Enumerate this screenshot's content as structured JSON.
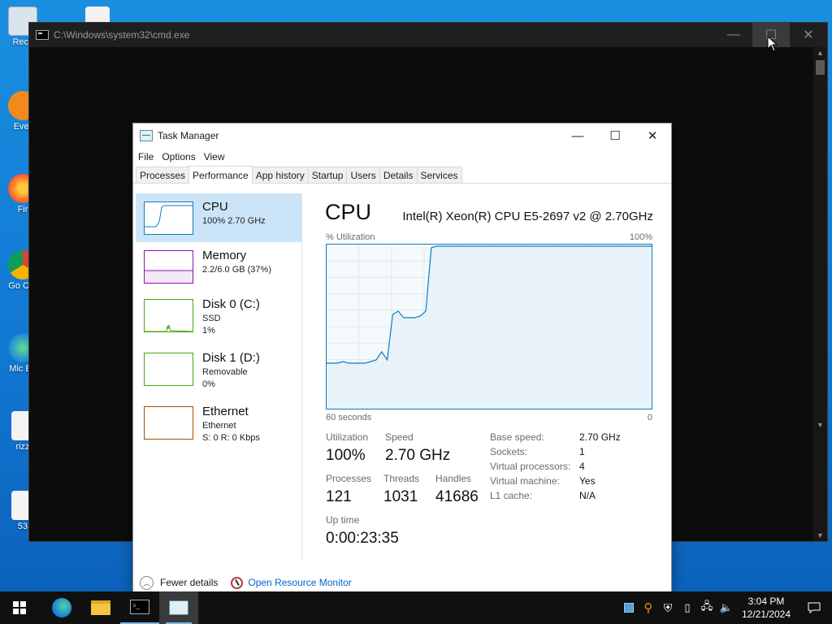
{
  "desktop": {
    "icons": [
      {
        "label": "Recy"
      },
      {
        "label": "Ever"
      },
      {
        "label": "Fir"
      },
      {
        "label": "Go Chr"
      },
      {
        "label": "Mic Ed"
      },
      {
        "label": "rizz"
      },
      {
        "label": "53"
      }
    ]
  },
  "cmd": {
    "title": "C:\\Windows\\system32\\cmd.exe",
    "minimize": "—",
    "maximize": "☐",
    "close": "✕"
  },
  "taskmgr": {
    "title": "Task Manager",
    "window_buttons": {
      "minimize": "—",
      "maximize": "☐",
      "close": "✕"
    },
    "menu": [
      "File",
      "Options",
      "View"
    ],
    "tabs": [
      "Processes",
      "Performance",
      "App history",
      "Startup",
      "Users",
      "Details",
      "Services"
    ],
    "selected_tab": "Performance",
    "resources": [
      {
        "name": "CPU",
        "sub1": "100%  2.70 GHz",
        "sub2": "",
        "color": "#117dbb"
      },
      {
        "name": "Memory",
        "sub1": "2.2/6.0 GB (37%)",
        "sub2": "",
        "color": "#8b12ae"
      },
      {
        "name": "Disk 0 (C:)",
        "sub1": "SSD",
        "sub2": "1%",
        "color": "#4da60c"
      },
      {
        "name": "Disk 1 (D:)",
        "sub1": "Removable",
        "sub2": "0%",
        "color": "#4da60c"
      },
      {
        "name": "Ethernet",
        "sub1": "Ethernet",
        "sub2": "S: 0  R: 0 Kbps",
        "color": "#a74f01"
      }
    ],
    "detail": {
      "title": "CPU",
      "model": "Intel(R) Xeon(R) CPU E5-2697 v2 @ 2.70GHz",
      "util_label": "% Utilization",
      "util_max": "100%",
      "x_left": "60 seconds",
      "x_right": "0",
      "stats": {
        "utilization_label": "Utilization",
        "utilization": "100%",
        "speed_label": "Speed",
        "speed": "2.70 GHz",
        "processes_label": "Processes",
        "processes": "121",
        "threads_label": "Threads",
        "threads": "1031",
        "handles_label": "Handles",
        "handles": "41686",
        "uptime_label": "Up time",
        "uptime": "0:00:23:35"
      },
      "specs": [
        {
          "k": "Base speed:",
          "v": "2.70 GHz"
        },
        {
          "k": "Sockets:",
          "v": "1"
        },
        {
          "k": "Virtual processors:",
          "v": "4"
        },
        {
          "k": "Virtual machine:",
          "v": "Yes"
        },
        {
          "k": "L1 cache:",
          "v": "N/A"
        }
      ],
      "cpu_history_pct": [
        28,
        28,
        28,
        29,
        28,
        28,
        28,
        28,
        29,
        30,
        35,
        30,
        58,
        60,
        56,
        56,
        56,
        57,
        60,
        99,
        100,
        100,
        100,
        100,
        100,
        100,
        100,
        100,
        100,
        100,
        100,
        100,
        100,
        100,
        100,
        100,
        100,
        100,
        100,
        100,
        100,
        100,
        100,
        100,
        100,
        100,
        100,
        100,
        100,
        100,
        100,
        100,
        100,
        100,
        100,
        100,
        100,
        100,
        100,
        100
      ]
    },
    "footer": {
      "fewer_details": "Fewer details",
      "open_resmon": "Open Resource Monitor"
    }
  },
  "taskbar": {
    "time": "3:04 PM",
    "date": "12/21/2024"
  }
}
